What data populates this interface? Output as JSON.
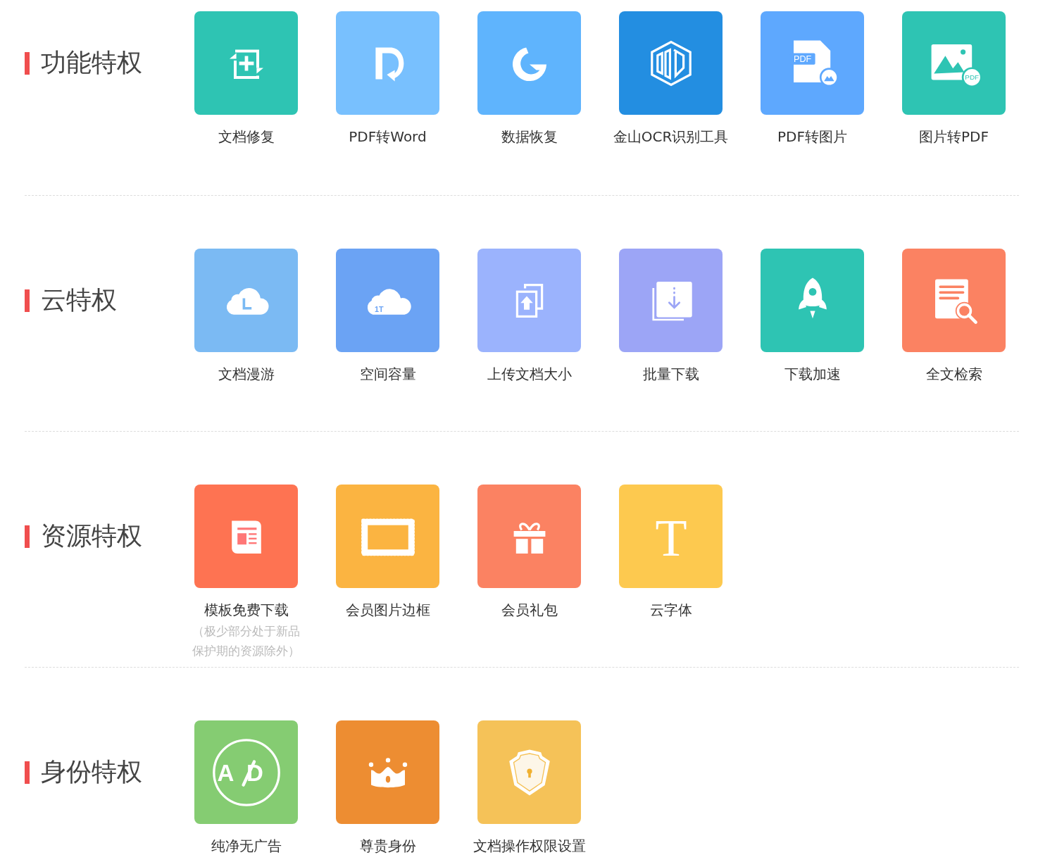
{
  "sections": [
    {
      "title": "功能特权",
      "items": [
        {
          "label": "文档修复",
          "color": "#2ec4b3"
        },
        {
          "label": "PDF转Word",
          "color": "#78c0fe"
        },
        {
          "label": "数据恢复",
          "color": "#5fb4fd"
        },
        {
          "label": "金山OCR识别工具",
          "color": "#238ee1"
        },
        {
          "label": "PDF转图片",
          "color": "#5ea8fe",
          "icon_text": "PDF"
        },
        {
          "label": "图片转PDF",
          "color": "#2ec4b3",
          "icon_text": "PDF"
        }
      ]
    },
    {
      "title": "云特权",
      "items": [
        {
          "label": "文档漫游",
          "color": "#7bbaf3"
        },
        {
          "label": "空间容量",
          "color": "#6ba3f4",
          "icon_text": "1T"
        },
        {
          "label": "上传文档大小",
          "color": "#9bb3fd"
        },
        {
          "label": "批量下载",
          "color": "#9ca5f6"
        },
        {
          "label": "下载加速",
          "color": "#2ec4b3"
        },
        {
          "label": "全文检索",
          "color": "#fb8262"
        }
      ]
    },
    {
      "title": "资源特权",
      "items": [
        {
          "label": "模板免费下载",
          "color": "#fe7352",
          "note": "（极少部分处于新品保护期的资源除外）"
        },
        {
          "label": "会员图片边框",
          "color": "#fbb441"
        },
        {
          "label": "会员礼包",
          "color": "#fb8262"
        },
        {
          "label": "云字体",
          "color": "#fdc94f",
          "icon_text": "T"
        }
      ]
    },
    {
      "title": "身份特权",
      "items": [
        {
          "label": "纯净无广告",
          "color": "#85cc72",
          "icon_text": "AD"
        },
        {
          "label": "尊贵身份",
          "color": "#ed8d32"
        },
        {
          "label": "文档操作权限设置",
          "color": "#f5c258"
        }
      ]
    }
  ]
}
